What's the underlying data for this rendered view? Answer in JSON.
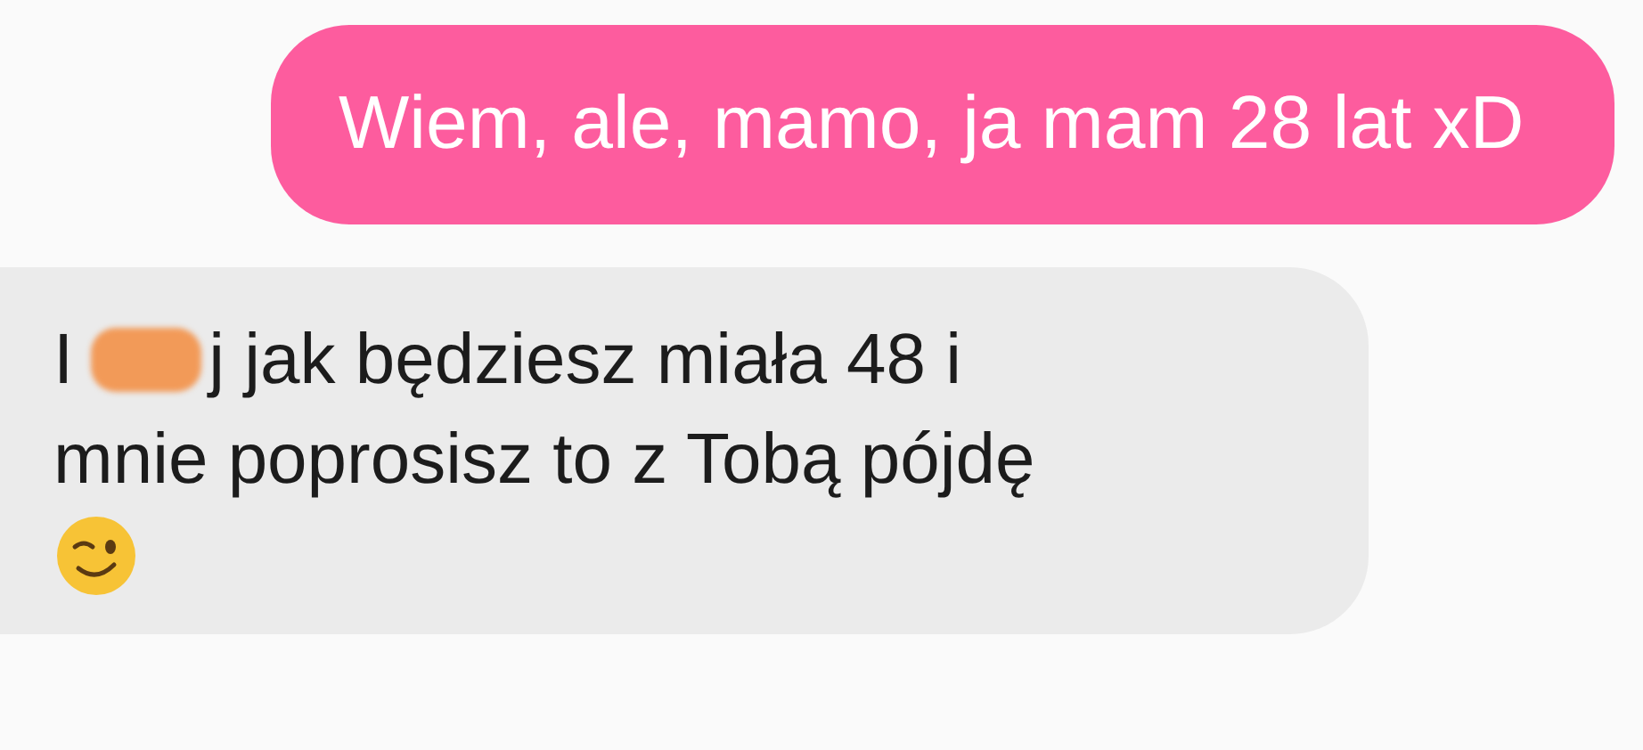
{
  "messages": [
    {
      "kind": "sent",
      "lines": [
        [
          {
            "kind": "text",
            "text": "Wiem, ale, mamo, ja mam 28 lat xD"
          }
        ]
      ]
    },
    {
      "kind": "received",
      "lines": [
        [
          {
            "kind": "text",
            "text": "I"
          },
          {
            "kind": "redaction"
          },
          {
            "kind": "text",
            "text": "j jak będziesz miała 48 i"
          }
        ],
        [
          {
            "kind": "text",
            "text": "mnie poprosisz to z Tobą pójdę"
          }
        ],
        [
          {
            "kind": "emoji"
          }
        ]
      ]
    }
  ]
}
